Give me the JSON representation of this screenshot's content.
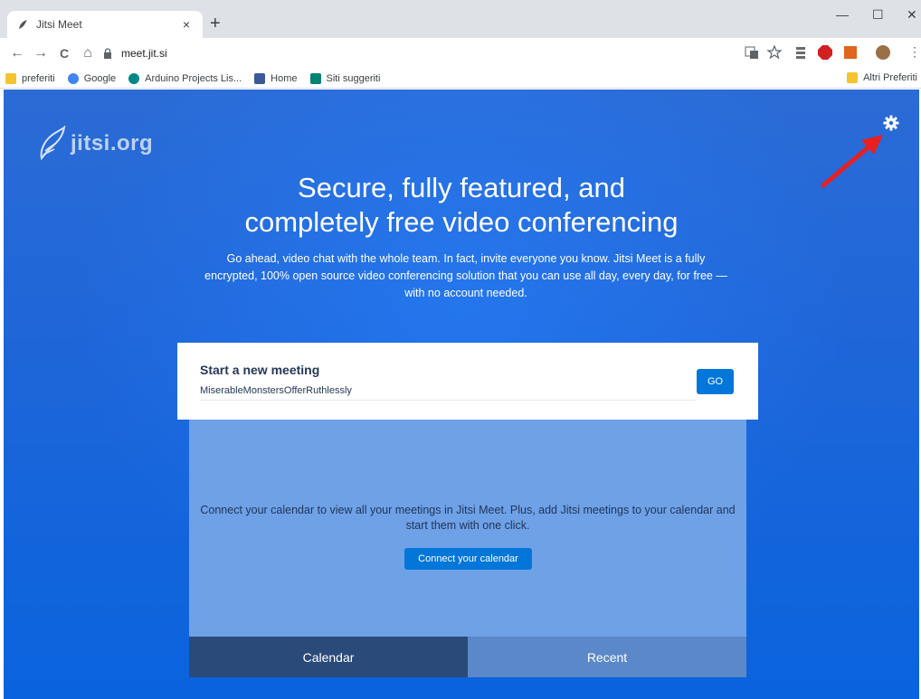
{
  "browser": {
    "tab_title": "Jitsi Meet",
    "tab_close": "×",
    "new_tab": "+",
    "window_min": "—",
    "window_max": "☐",
    "window_close": "✕",
    "nav": {
      "back": "←",
      "forward": "→",
      "reload": "C",
      "home": "⌂"
    },
    "url": "meet.jit.si",
    "bookmarks": [
      {
        "label": "preferiti",
        "icon": "folder-icon",
        "color": "#f4c430"
      },
      {
        "label": "Google",
        "icon": "google-icon",
        "color": "#4285f4"
      },
      {
        "label": "Arduino Projects Lis...",
        "icon": "arduino-icon",
        "color": "#00878a"
      },
      {
        "label": "Home",
        "icon": "facebook-icon",
        "color": "#3b5998"
      },
      {
        "label": "Siti suggeriti",
        "icon": "bing-icon",
        "color": "#008373"
      }
    ],
    "other_bookmarks": "Altri Preferiti"
  },
  "page": {
    "logo_text": "jitsi.org",
    "headline_line1": "Secure, fully featured, and",
    "headline_line2": "completely free video conferencing",
    "subtitle": "Go ahead, video chat with the whole team. In fact, invite everyone you know. Jitsi Meet is a fully encrypted, 100% open source video conferencing solution that you can use all day, every day, for free — with no account needed.",
    "start_label": "Start a new meeting",
    "room_name": "MiserableMonstersOfferRuthlessly",
    "go_label": "GO",
    "calendar_message": "Connect your calendar to view all your meetings in Jitsi Meet. Plus, add Jitsi meetings to your calendar and start them with one click.",
    "connect_label": "Connect your calendar",
    "tabs": [
      "Calendar",
      "Recent"
    ]
  },
  "colors": {
    "accent": "#0376da",
    "annotation_arrow": "#e8201f"
  }
}
